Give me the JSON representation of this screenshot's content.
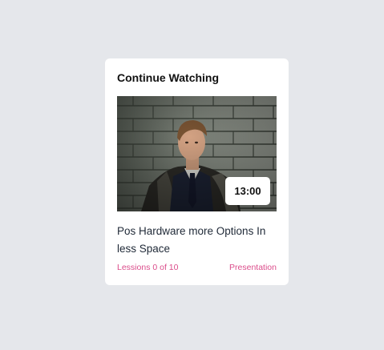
{
  "card": {
    "title": "Continue Watching",
    "video": {
      "duration": "13:00",
      "title": "Pos Hardware more Options In less Space",
      "lessons": "Lessions 0 of 10",
      "category": "Presentation"
    }
  },
  "colors": {
    "page_background": "#e5e7eb",
    "card_background": "#ffffff",
    "accent_pink": "#db4d8b",
    "text_dark": "#111111"
  }
}
